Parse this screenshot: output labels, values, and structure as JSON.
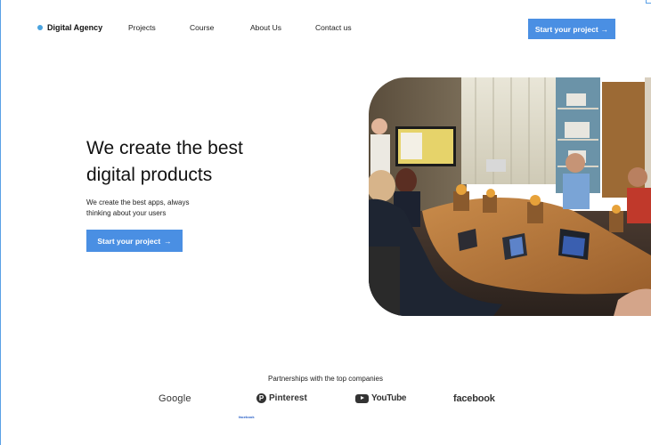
{
  "nav": {
    "brand": "Digital Agency",
    "links": [
      "Projects",
      "Course",
      "About Us",
      "Contact us"
    ],
    "cta_label": "Start your project",
    "cta_arrow": "→"
  },
  "hero": {
    "title_line1": "We create the best",
    "title_line2": "digital products",
    "subtitle_line1": "We create the best apps, always",
    "subtitle_line2": "thinking about your users",
    "cta_label": "Start your project",
    "cta_arrow": "→"
  },
  "partners": {
    "title": "Partnerships with the top companies",
    "logos": [
      "Google",
      "Pinterest",
      "YouTube",
      "facebook"
    ],
    "small_logo": "facebook"
  },
  "colors": {
    "accent": "#4a8fe3",
    "brand_dot": "#4aa3df"
  }
}
